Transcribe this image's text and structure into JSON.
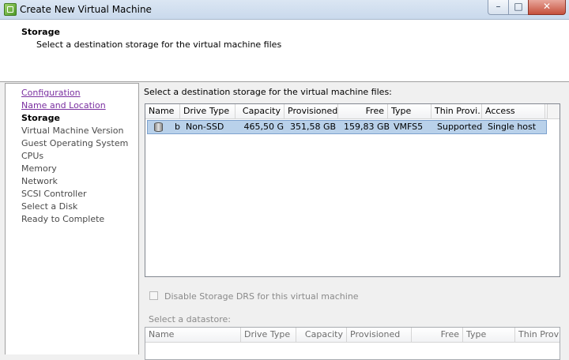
{
  "window": {
    "title": "Create New Virtual Machine",
    "minimize_glyph": "–",
    "maximize_glyph": "□",
    "close_glyph": "✕"
  },
  "header": {
    "title": "Storage",
    "subtitle": "Select a destination storage for the virtual machine files"
  },
  "nav": {
    "items": [
      {
        "label": "Configuration",
        "state": "link"
      },
      {
        "label": "Name and Location",
        "state": "link"
      },
      {
        "label": "Storage",
        "state": "current"
      },
      {
        "label": "Virtual Machine Version",
        "state": "pending"
      },
      {
        "label": "Guest Operating System",
        "state": "pending"
      },
      {
        "label": "CPUs",
        "state": "pending"
      },
      {
        "label": "Memory",
        "state": "pending"
      },
      {
        "label": "Network",
        "state": "pending"
      },
      {
        "label": "SCSI Controller",
        "state": "pending"
      },
      {
        "label": "Select a Disk",
        "state": "pending"
      },
      {
        "label": "Ready to Complete",
        "state": "pending"
      }
    ]
  },
  "main": {
    "label": "Select a destination storage for the virtual machine files:",
    "table": {
      "columns": [
        "Name",
        "Drive Type",
        "Capacity",
        "Provisioned",
        "Free",
        "Type",
        "Thin Provi...",
        "Access"
      ],
      "rows": [
        {
          "name": "b",
          "drive_type": "Non-SSD",
          "capacity": "465,50 G",
          "provisioned": "351,58 GB",
          "free": "159,83 GB",
          "type": "VMFS5",
          "thin": "Supported",
          "access": "Single host",
          "icon": "datastore-icon",
          "selected": true
        }
      ]
    },
    "drs_checkbox": {
      "label": "Disable Storage DRS for this virtual machine",
      "checked": false,
      "enabled": false
    },
    "datastore_label": "Select a datastore:",
    "datastore_table": {
      "columns": [
        "Name",
        "Drive Type",
        "Capacity",
        "Provisioned",
        "Free",
        "Type",
        "Thin Provi"
      ]
    }
  },
  "colors": {
    "selected_row": "#b9d1ea",
    "link": "#7a2fa0",
    "disabled_text": "#8a8a8a"
  }
}
